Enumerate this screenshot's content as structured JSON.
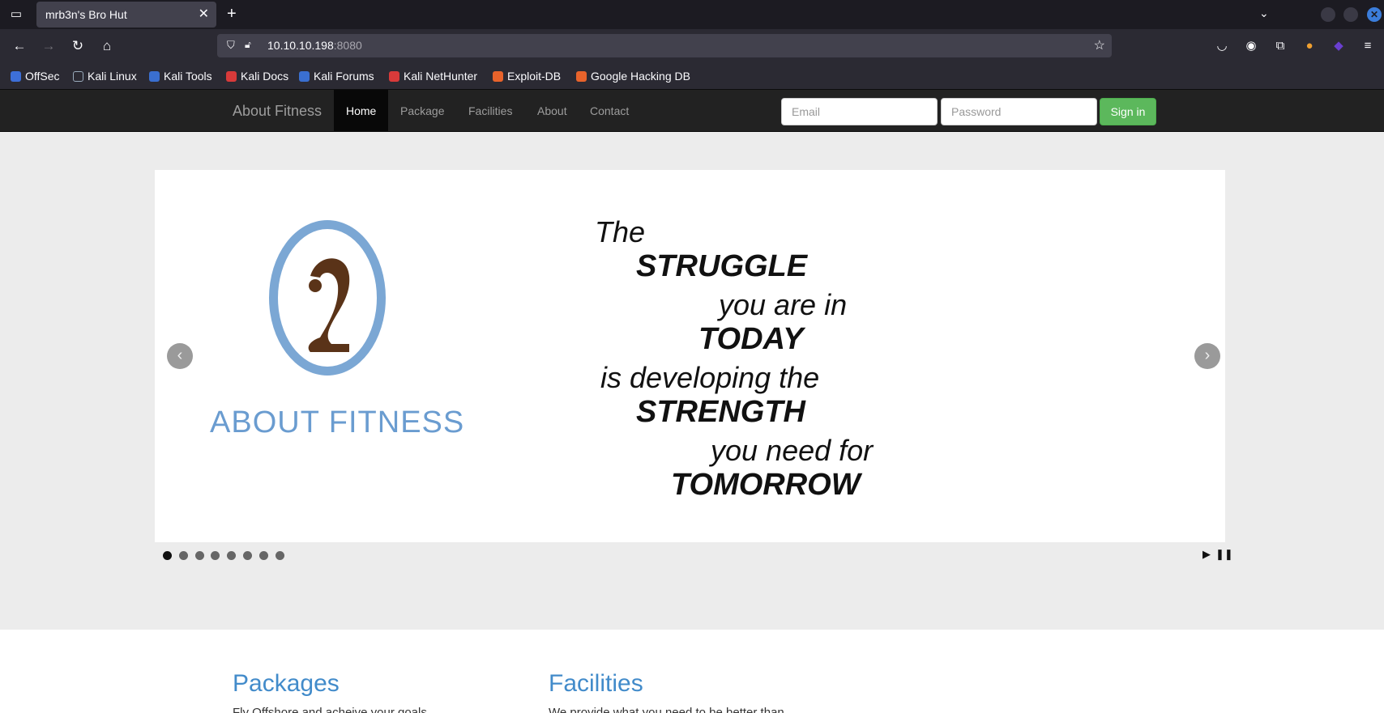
{
  "browser": {
    "tab_title": "mrb3n's Bro Hut",
    "url_host": "10.10.10.198",
    "url_port": ":8080",
    "bookmarks": [
      "OffSec",
      "Kali Linux",
      "Kali Tools",
      "Kali Docs",
      "Kali Forums",
      "Kali NetHunter",
      "Exploit-DB",
      "Google Hacking DB"
    ],
    "icons": [
      "tab-list-icon",
      "close-icon",
      "plus-icon",
      "chevron-down-icon",
      "back-icon",
      "forward-icon",
      "reload-icon",
      "home-icon",
      "shield-icon",
      "lock-icon",
      "star-icon",
      "pocket-icon",
      "account-icon",
      "extensions-icon",
      "menu-icon"
    ]
  },
  "site": {
    "brand": "About Fitness",
    "nav": [
      "Home",
      "Package",
      "Facilities",
      "About",
      "Contact"
    ],
    "active_nav": "Home",
    "email_placeholder": "Email",
    "password_placeholder": "Password",
    "signin_label": "Sign in",
    "colors": {
      "navbar": "#222222",
      "signin": "#5cb85c",
      "heading": "#428bca"
    }
  },
  "slider": {
    "logo_text": "ABOUT FITNESS",
    "quote": [
      "The",
      "STRUGGLE",
      "you are in",
      "TODAY",
      "is developing the",
      "STRENGTH",
      "you need for",
      "TOMORROW"
    ],
    "slide_count": 8,
    "current_slide": 1,
    "controls": [
      "play-icon",
      "pause-icon"
    ]
  },
  "sections": [
    {
      "title": "Packages",
      "text": "Fly Offshore and acheive your goals."
    },
    {
      "title": "Facilities",
      "text": "We provide what you need to be better than"
    }
  ]
}
